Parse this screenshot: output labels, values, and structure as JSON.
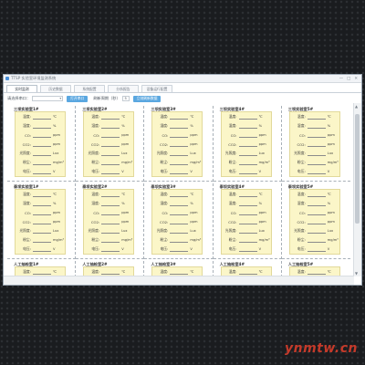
{
  "window": {
    "title": "TTSP 实验室环境监测系统",
    "tabs": [
      {
        "label": "实时监测",
        "active": true
      },
      {
        "label": "历史数据",
        "active": false
      },
      {
        "label": "系统配置",
        "active": false
      },
      {
        "label": "分析报告",
        "active": false
      },
      {
        "label": "设备运行配置",
        "active": false
      }
    ]
  },
  "toolbar": {
    "port_label": "请选择串口：",
    "port_value": "",
    "open_port_button": "打开串口",
    "interval_label": "刷新周期（秒）",
    "interval_value": "5",
    "refresh_button": "立刻刷新数据"
  },
  "field_labels": {
    "temp": "温度:",
    "humidity": "湿度:",
    "co": "CO:",
    "co2": "CO2:",
    "light": "光照度:",
    "particulates": "粉尘:",
    "power": "电压:"
  },
  "units": {
    "temp": "℃",
    "humidity": "%",
    "co": "ppm",
    "co2": "ppm",
    "light": "Lux",
    "particulates": "mg/m³",
    "power": "V"
  },
  "rows": [
    {
      "titles": [
        "三坝实验室1#",
        "三坝实验室2#",
        "三坝实验室3#",
        "三坝实验室4#",
        "三坝实验室5#"
      ]
    },
    {
      "titles": [
        "泰坝实验室1#",
        "泰坝实验室2#",
        "泰坝实验室3#",
        "泰坝实验室4#",
        "泰坝实验室5#"
      ]
    },
    {
      "titles": [
        "人工抽检室1#",
        "人工抽检室2#",
        "人工抽检室3#",
        "人工抽检室4#",
        "人工抽检室5#"
      ]
    }
  ],
  "icons": {
    "app": "app-icon",
    "minimize": "minimize-icon",
    "maximize": "maximize-icon",
    "close": "close-icon"
  },
  "watermark": "ynmtw.cn"
}
